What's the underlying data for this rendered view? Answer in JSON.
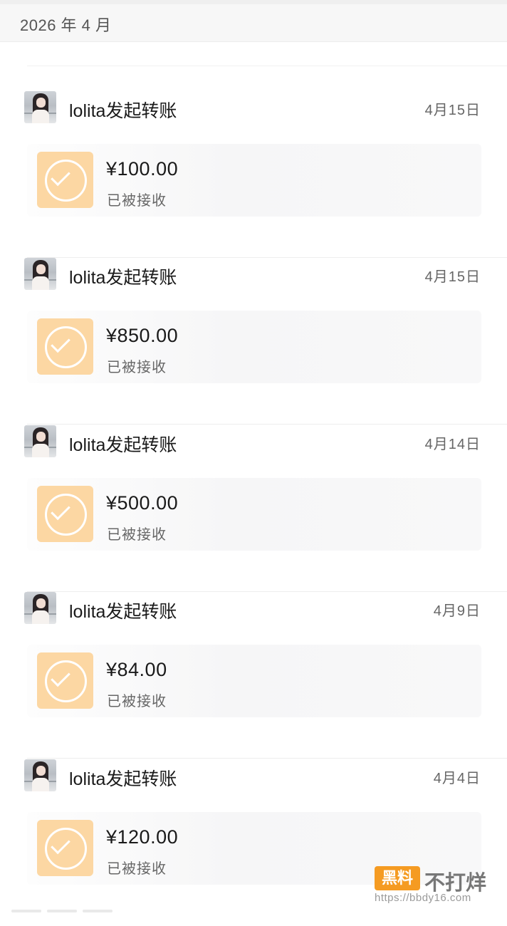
{
  "month_header": "2026 年 4 月",
  "records": [
    {
      "title": "lolita发起转账",
      "date": "4月15日",
      "amount": "¥100.00",
      "status": "已被接收"
    },
    {
      "title": "lolita发起转账",
      "date": "4月15日",
      "amount": "¥850.00",
      "status": "已被接收"
    },
    {
      "title": "lolita发起转账",
      "date": "4月14日",
      "amount": "¥500.00",
      "status": "已被接收"
    },
    {
      "title": "lolita发起转账",
      "date": "4月9日",
      "amount": "¥84.00",
      "status": "已被接收"
    },
    {
      "title": "lolita发起转账",
      "date": "4月4日",
      "amount": "¥120.00",
      "status": "已被接收"
    }
  ],
  "icons": {
    "avatar": "user-avatar-photo",
    "status_tile": "check-circle-icon"
  },
  "colors": {
    "status_tile": "#fcd7a3",
    "watermark_badge": "#f59b22"
  },
  "watermark": {
    "badge": "黑料",
    "text": "不打烊",
    "url": "https://bbdy16.com"
  }
}
